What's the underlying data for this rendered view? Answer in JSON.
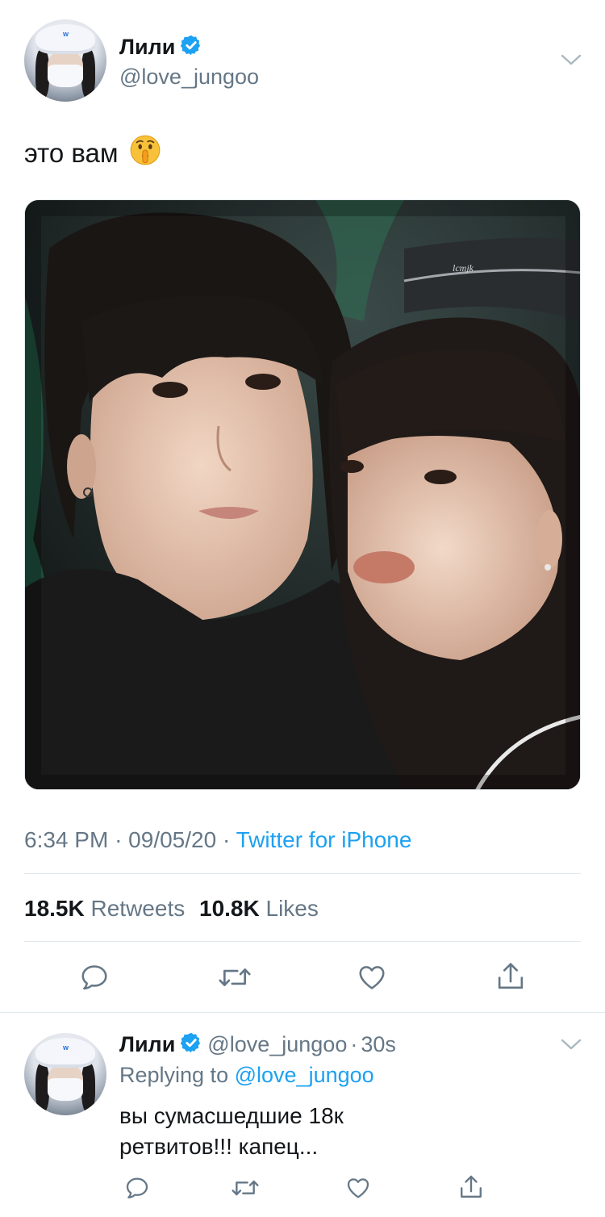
{
  "tweet": {
    "author": {
      "display_name": "Лили",
      "handle": "@love_jungoo",
      "verified": true
    },
    "text": "это вам",
    "emoji": "shushing-face",
    "photo_watermark": "lcmjk",
    "timestamp": "6:34 PM",
    "date": "09/05/20",
    "separator": "·",
    "source": "Twitter for iPhone",
    "stats": {
      "retweets_count": "18.5K",
      "retweets_label": "Retweets",
      "likes_count": "10.8K",
      "likes_label": "Likes"
    },
    "actions": [
      "reply-icon",
      "retweet-icon",
      "like-icon",
      "share-icon"
    ]
  },
  "reply": {
    "author": {
      "display_name": "Лили",
      "handle": "@love_jungoo",
      "verified": true
    },
    "separator": "·",
    "time_ago": "30s",
    "replying_label": "Replying to",
    "replying_to": "@love_jungoo",
    "text": "вы сумасшедшие 18к ретвитов!!! капец...",
    "actions": [
      "reply-icon",
      "retweet-icon",
      "like-icon",
      "share-icon"
    ]
  },
  "colors": {
    "accent": "#1da1f2",
    "text_primary": "#14171a",
    "text_secondary": "#657786",
    "divider": "#e1e8ed",
    "icon_gray": "#657786"
  }
}
